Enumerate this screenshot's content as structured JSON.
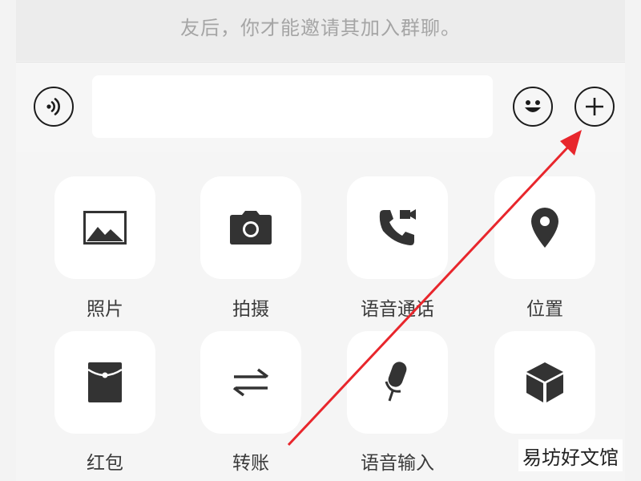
{
  "notice": {
    "text": "友后，你才能邀请其加入群聊。"
  },
  "input_bar": {
    "voice_icon": "voice-wave-icon",
    "text_value": "",
    "emoji_icon": "smiley-face-icon",
    "more_icon": "plus-circle-icon"
  },
  "actions": [
    {
      "label": "照片",
      "icon": "image-icon"
    },
    {
      "label": "拍摄",
      "icon": "camera-icon"
    },
    {
      "label": "语音通话",
      "icon": "phone-video-icon"
    },
    {
      "label": "位置",
      "icon": "location-pin-icon"
    },
    {
      "label": "红包",
      "icon": "red-envelope-icon"
    },
    {
      "label": "转账",
      "icon": "transfer-arrows-icon"
    },
    {
      "label": "语音输入",
      "icon": "microphone-icon"
    },
    {
      "label": "",
      "icon": "cube-icon"
    }
  ],
  "watermark": {
    "text": "易坊好文馆"
  },
  "annotation": {
    "color": "#e8262c"
  }
}
